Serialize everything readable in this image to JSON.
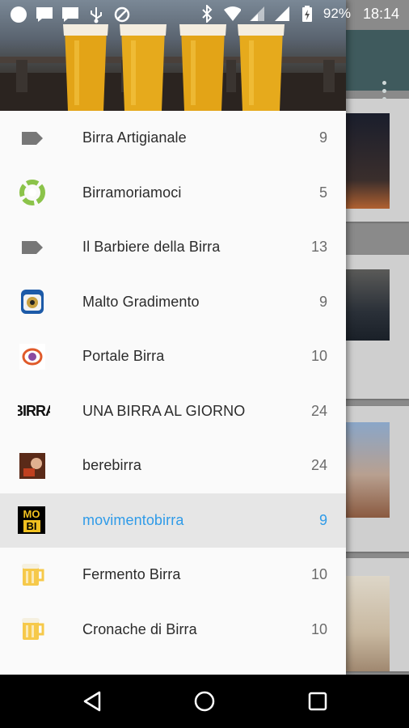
{
  "status_bar": {
    "battery": "92%",
    "time": "18:14"
  },
  "drawer": {
    "items": [
      {
        "label": "Birra Artigianale",
        "count": "9",
        "icon": "tag-icon"
      },
      {
        "label": "Birramoriamoci",
        "count": "5",
        "icon": "green-recycle-logo-icon"
      },
      {
        "label": "Il Barbiere della Birra",
        "count": "13",
        "icon": "tag-icon"
      },
      {
        "label": "Malto Gradimento",
        "count": "9",
        "icon": "malto-gradimento-logo-icon"
      },
      {
        "label": "Portale Birra",
        "count": "10",
        "icon": "portale-birra-logo-icon"
      },
      {
        "label": "UNA BIRRA AL GIORNO",
        "count": "24",
        "icon": "birra-text-logo-icon"
      },
      {
        "label": "berebirra",
        "count": "24",
        "icon": "berebirra-avatar-icon"
      },
      {
        "label": "movimentobirra",
        "count": "9",
        "icon": "mobi-logo-icon",
        "selected": true
      },
      {
        "label": "Fermento Birra",
        "count": "10",
        "icon": "beer-mug-icon"
      },
      {
        "label": "Cronache di Birra",
        "count": "10",
        "icon": "beer-mug-icon"
      }
    ],
    "logo_text": "BIRRA",
    "mobi_text": [
      "MO",
      "BI"
    ]
  },
  "colors": {
    "selected_accent": "#2f9be8",
    "toolbar": "#3f5a5d"
  }
}
